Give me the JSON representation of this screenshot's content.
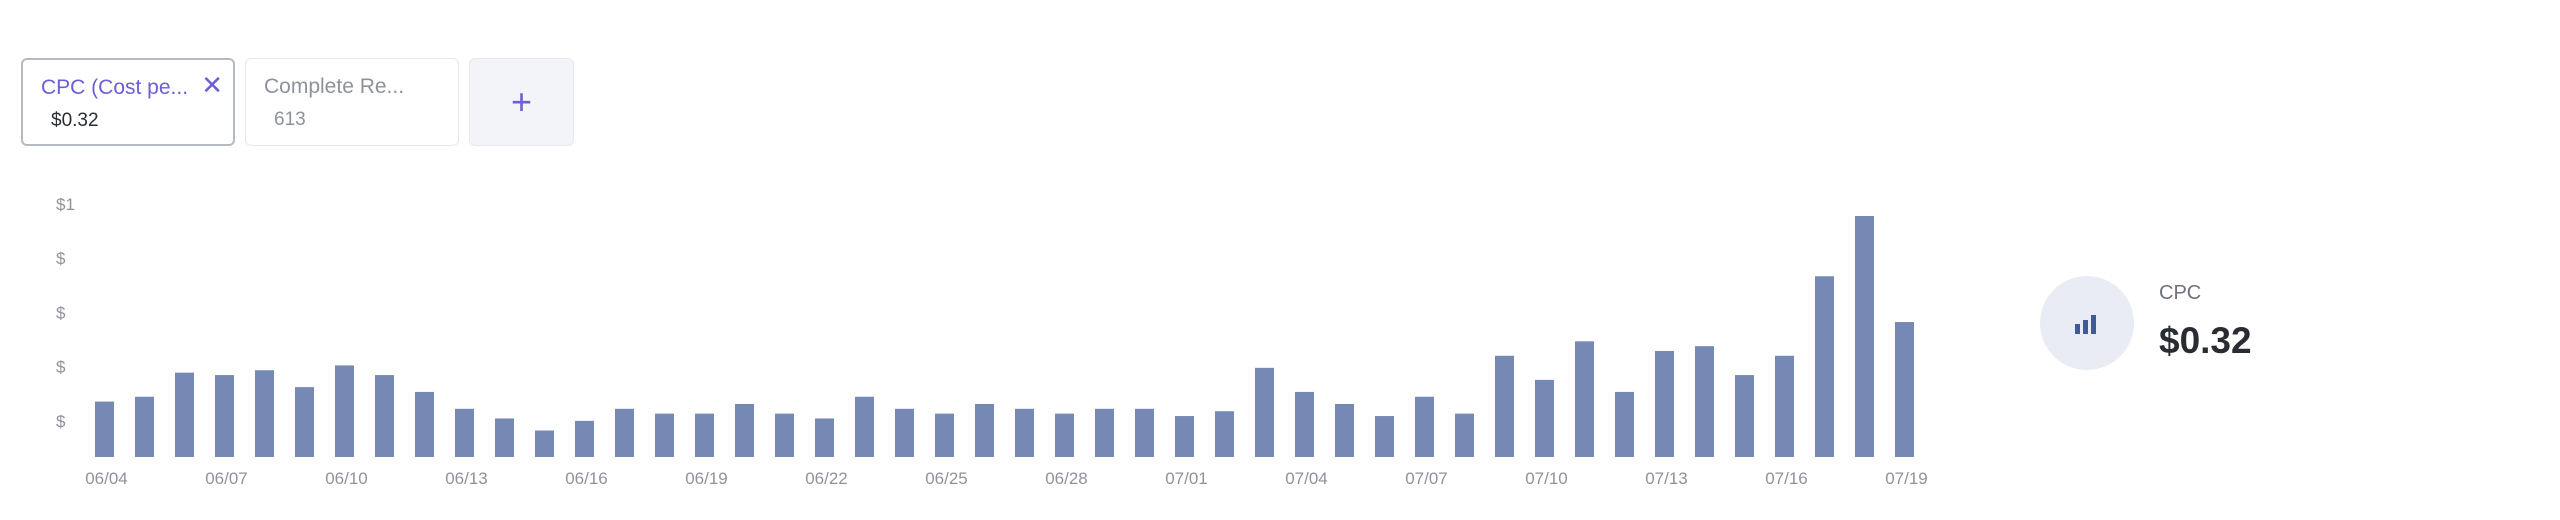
{
  "metrics": [
    {
      "label": "CPC (Cost pe...",
      "value": "$0.32",
      "active": true
    },
    {
      "label": "Complete Re...",
      "value": "613",
      "active": false
    }
  ],
  "add_label": "+",
  "close_label": "✕",
  "summary": {
    "label": "CPC",
    "value": "$0.32",
    "icon": "bar-chart-icon"
  },
  "colors": {
    "bar": "#7689b4",
    "accent": "#6a5fd6",
    "tick": "#8e929c"
  },
  "chart_data": {
    "type": "bar",
    "y_tick_labels": [
      "$1",
      "$",
      "$",
      "$",
      "$"
    ],
    "x_tick_labels": [
      "06/04",
      "06/07",
      "06/10",
      "06/13",
      "06/16",
      "06/19",
      "06/22",
      "06/25",
      "06/28",
      "07/01",
      "07/04",
      "07/07",
      "07/10",
      "07/13",
      "07/16",
      "07/19"
    ],
    "categories": [
      "06/04",
      "06/05",
      "06/06",
      "06/07",
      "06/08",
      "06/09",
      "06/10",
      "06/11",
      "06/12",
      "06/13",
      "06/14",
      "06/15",
      "06/16",
      "06/17",
      "06/18",
      "06/19",
      "06/20",
      "06/21",
      "06/22",
      "06/23",
      "06/24",
      "06/25",
      "06/26",
      "06/27",
      "06/28",
      "06/29",
      "06/30",
      "07/01",
      "07/02",
      "07/03",
      "07/04",
      "07/05",
      "07/06",
      "07/07",
      "07/08",
      "07/09",
      "07/10",
      "07/11",
      "07/12",
      "07/13",
      "07/14",
      "07/15",
      "07/16",
      "07/17",
      "07/18",
      "07/19"
    ],
    "values": [
      0.23,
      0.25,
      0.35,
      0.34,
      0.36,
      0.29,
      0.38,
      0.34,
      0.27,
      0.2,
      0.16,
      0.11,
      0.15,
      0.2,
      0.18,
      0.18,
      0.22,
      0.18,
      0.16,
      0.25,
      0.2,
      0.18,
      0.22,
      0.2,
      0.18,
      0.2,
      0.2,
      0.17,
      0.19,
      0.37,
      0.27,
      0.22,
      0.17,
      0.25,
      0.18,
      0.42,
      0.32,
      0.48,
      0.27,
      0.44,
      0.46,
      0.34,
      0.42,
      0.75,
      1.0,
      0.56
    ],
    "ylim": [
      0,
      1
    ],
    "grid": false,
    "legend": "none"
  }
}
